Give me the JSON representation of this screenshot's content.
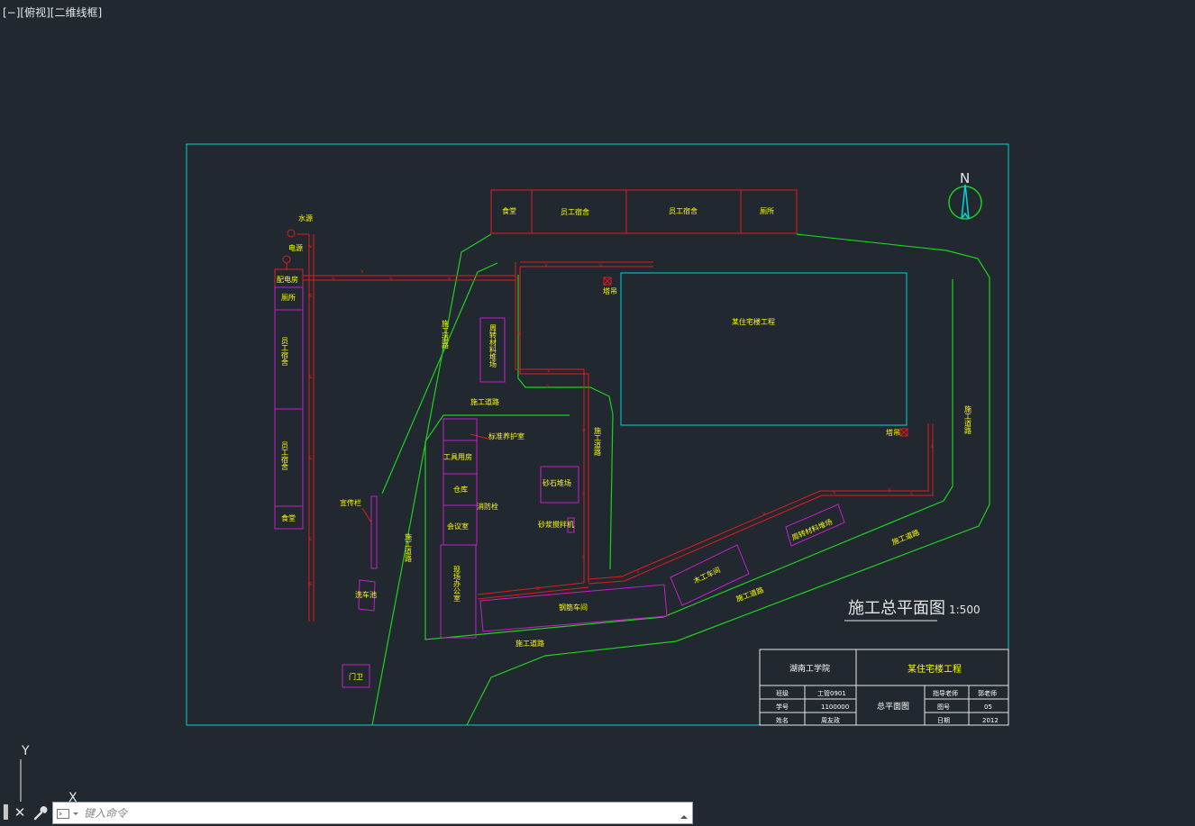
{
  "viewport": {
    "label": "[−][俯视][二维线框]"
  },
  "compass": {
    "north": "N"
  },
  "ucs": {
    "y_label": "Y",
    "x_label": "X"
  },
  "drawing": {
    "title": "施工总平面图",
    "scale": "1:500",
    "top_buildings": [
      "食堂",
      "员工宿舍",
      "员工宿舍",
      "厕所"
    ],
    "left_column": {
      "water_source": "水源",
      "power_source": "电源",
      "distribution_room": "配电房",
      "toilet": "厕所",
      "dorm_1": "员工宿舍",
      "dorm_2": "员工宿舍",
      "canteen": "食堂"
    },
    "main_building": "某住宅楼工程",
    "tower_crane_1": "塔吊",
    "tower_crane_2": "塔吊",
    "roads": {
      "road_upper_left": "施工道路",
      "road_middle": "施工道路",
      "road_center_vertical": "施工道路",
      "road_left_vertical": "施工道路",
      "road_right_vertical": "施工道路",
      "road_bottom_left": "施工道路",
      "road_bottom_center": "施工道路",
      "road_bottom_right": "施工道路"
    },
    "facilities": {
      "material_yard": "周转材料堆场",
      "curing_room": "标准养护室",
      "tool_room": "工具用房",
      "warehouse": "仓库",
      "fire_hydrant": "消防栓",
      "meeting_room": "会议室",
      "site_office": "现场办公室",
      "sand_yard": "砂石堆场",
      "mortar_mixer": "砂浆搅拌机",
      "rebar_shed": "钢筋车间",
      "carpentry_shed": "木工车间",
      "material_yard_2": "周转材料堆场",
      "billboard": "宣传栏",
      "car_wash": "洗车池",
      "guard_room": "门卫"
    },
    "title_block": {
      "company": "湖南工学院",
      "project": "某住宅楼工程",
      "rows": [
        [
          "班级",
          "工管0901"
        ],
        [
          "学号",
          "1100000"
        ],
        [
          "姓名",
          "周友政"
        ]
      ],
      "drawing_name": "总平面图",
      "right_rows": [
        [
          "指导老师",
          "郭老师"
        ],
        [
          "图号",
          "05"
        ],
        [
          "日期",
          "2012"
        ]
      ]
    }
  },
  "command_line": {
    "placeholder": "键入命令",
    "close": "✕"
  },
  "colors": {
    "background": "#212830",
    "frame": "#00d6d6",
    "wall": "#e01c1c",
    "road": "#1fd01f",
    "facility": "#c81ec8",
    "text": "#ffff00"
  }
}
